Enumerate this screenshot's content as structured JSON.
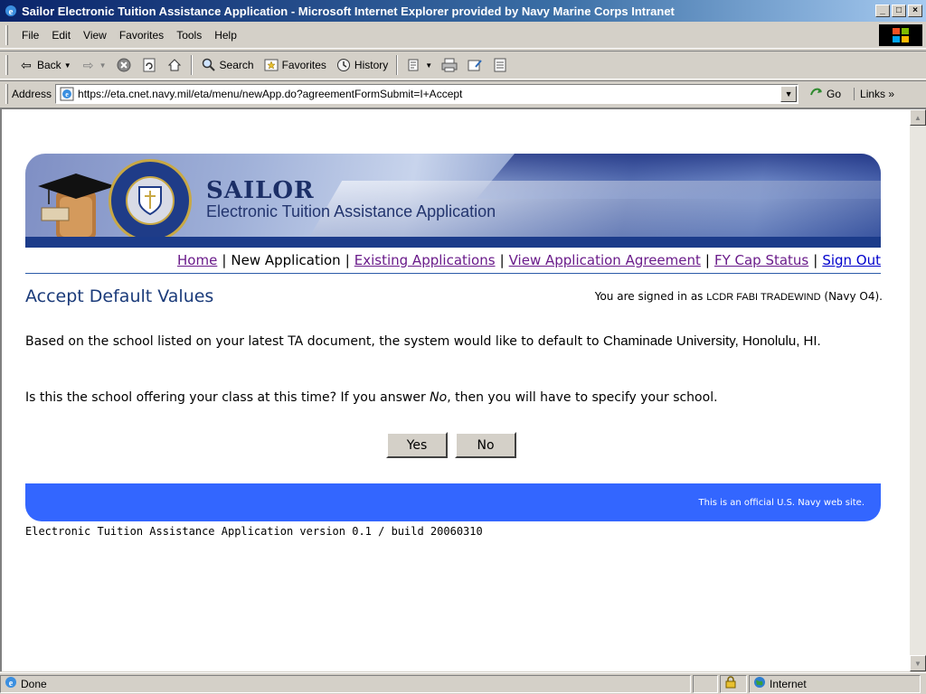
{
  "window": {
    "title": "Sailor Electronic Tuition Assistance Application - Microsoft Internet Explorer provided by Navy Marine Corps Intranet",
    "minimize": "_",
    "maximize": "□",
    "close": "×"
  },
  "menu": [
    "File",
    "Edit",
    "View",
    "Favorites",
    "Tools",
    "Help"
  ],
  "toolbar": {
    "back": "Back",
    "search": "Search",
    "favorites": "Favorites",
    "history": "History"
  },
  "address": {
    "label": "Address",
    "url": "https://eta.cnet.navy.mil/eta/menu/newApp.do?agreementFormSubmit=I+Accept",
    "go": "Go",
    "links": "Links »"
  },
  "banner": {
    "title": "SAILOR",
    "subtitle": "Electronic Tuition Assistance Application"
  },
  "nav": {
    "home": "Home",
    "new_application": "New Application",
    "existing_applications": "Existing Applications",
    "view_agreement": "View Application Agreement",
    "fy_cap_status": "FY Cap Status",
    "sign_out": "Sign Out"
  },
  "page": {
    "heading": "Accept Default Values",
    "signed_prefix": "You are signed in as",
    "user_name": "LCDR FABI TRADEWIND",
    "user_rank": "(Navy O4).",
    "para1_text": "Based on the school listed on your latest TA document, the system would like to default to",
    "school": "Chaminade University, Honolulu, HI.",
    "para2_before": "Is this the school offering your class at this time? If you answer",
    "para2_no": "No",
    "para2_after": ", then you will have to specify your school.",
    "yes_label": "Yes",
    "no_label": "No",
    "official": "This is an official U.S. Navy web site.",
    "version": "Electronic Tuition Assistance Application version 0.1 / build 20060310"
  },
  "status": {
    "text": "Done",
    "zone": "Internet"
  },
  "colors": {
    "title_bar": "#0a246a",
    "heading": "#1b3b7a",
    "footer_bar": "#3366ff",
    "visited_link": "#6a1b8a",
    "link": "#0000cc"
  }
}
